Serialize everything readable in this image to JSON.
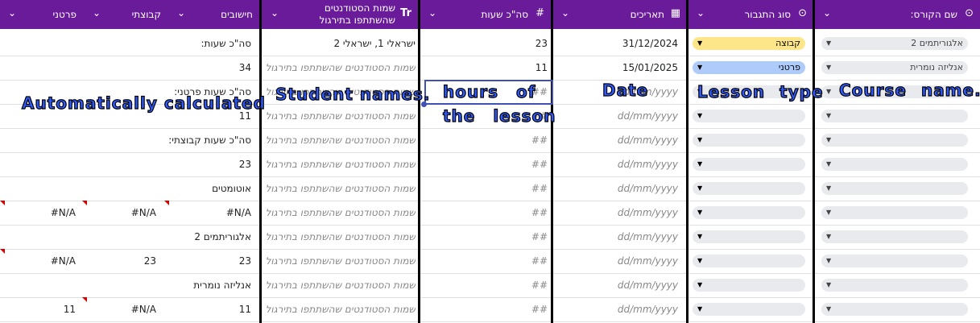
{
  "headers": {
    "course": {
      "label": "שם הקורס:",
      "icon": "dropdown-icon"
    },
    "type": {
      "label": "סוג התגבור",
      "icon": "dropdown-icon"
    },
    "date": {
      "label": "תאריכים",
      "icon": "calendar-icon"
    },
    "hours": {
      "label": "סה\"כ שעות",
      "icon": "hash-icon"
    },
    "students": {
      "label": "שמות הסטודנטים",
      "label2": "שהשתתפו בתירגול",
      "icon": "text-icon"
    },
    "calc": {
      "label": "חישובים"
    },
    "group": {
      "label": "קבוצתי"
    },
    "private": {
      "label": "פרטני"
    }
  },
  "placeholders": {
    "date": "dd/mm/yyyy",
    "hours": "##",
    "students": "שמות הסטודנטים שהשתתפו בתירגול"
  },
  "rows": [
    {
      "course": "אלגוריתמים 2",
      "type": "קבוצה",
      "type_color": "#fde68a",
      "date": "31/12/2024",
      "hours": "23",
      "students": "ישראלי 1, ישראלי 2",
      "calc": "סה\"כ שעות:",
      "group": "",
      "private": ""
    },
    {
      "course": "אנליזה נומרית",
      "type": "פרטני",
      "type_color": "#aecbfa",
      "date": "15/01/2025",
      "hours": "11",
      "students": "",
      "calc": "34",
      "group": "",
      "private": ""
    },
    {
      "course": "",
      "type": "",
      "date": "",
      "hours": "",
      "students": "",
      "calc": "סה\"כ שעות פרטני:",
      "group": "",
      "private": ""
    },
    {
      "course": "",
      "type": "",
      "date": "",
      "hours": "",
      "students": "",
      "calc": "11",
      "group": "",
      "private": ""
    },
    {
      "course": "",
      "type": "",
      "date": "",
      "hours": "",
      "students": "",
      "calc": "סה\"כ שעות קבוצתי:",
      "group": "",
      "private": ""
    },
    {
      "course": "",
      "type": "",
      "date": "",
      "hours": "",
      "students": "",
      "calc": "23",
      "group": "",
      "private": ""
    },
    {
      "course": "",
      "type": "",
      "date": "",
      "hours": "",
      "students": "",
      "calc": "אוטומטים",
      "group": "",
      "private": ""
    },
    {
      "course": "",
      "type": "",
      "date": "",
      "hours": "",
      "students": "",
      "calc": "#N/A",
      "group": "#N/A",
      "private": "#N/A"
    },
    {
      "course": "",
      "type": "",
      "date": "",
      "hours": "",
      "students": "",
      "calc": "אלגוריתמים 2",
      "group": "",
      "private": ""
    },
    {
      "course": "",
      "type": "",
      "date": "",
      "hours": "",
      "students": "",
      "calc": "23",
      "group": "23",
      "private": "#N/A"
    },
    {
      "course": "",
      "type": "",
      "date": "",
      "hours": "",
      "students": "",
      "calc": "אנליזה נומרית",
      "group": "",
      "private": ""
    },
    {
      "course": "",
      "type": "",
      "date": "",
      "hours": "",
      "students": "",
      "calc": "11",
      "group": "#N/A",
      "private": "11"
    }
  ],
  "annotations": {
    "calc": "Automatically calculated",
    "students": "Student names.",
    "hours1": "hours of",
    "hours2": "the lesson",
    "date": "Date",
    "type": "Lesson type",
    "course": "Course name."
  }
}
